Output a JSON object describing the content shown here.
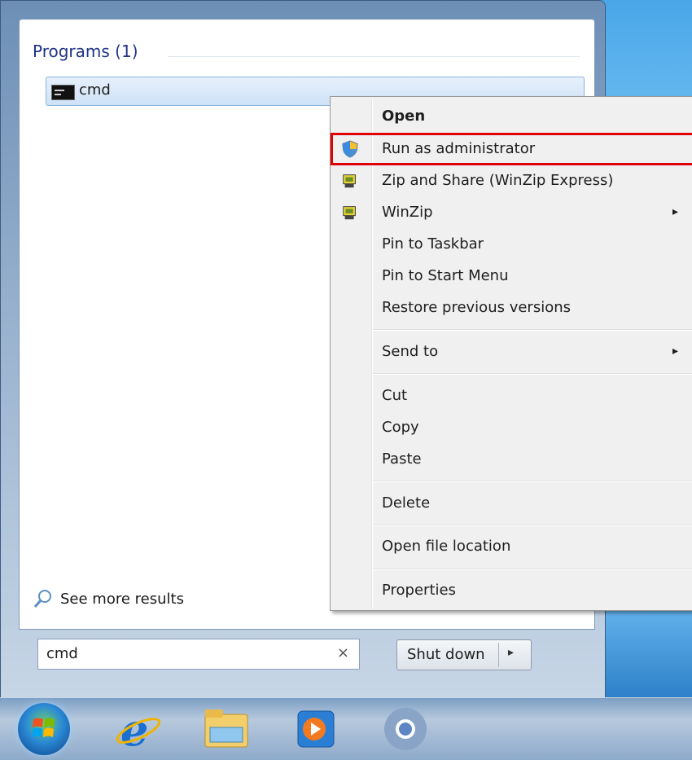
{
  "start_menu": {
    "programs_header": "Programs (1)",
    "program_items": [
      {
        "label": "cmd",
        "icon": "cmd-console-icon"
      }
    ],
    "see_more": "See more results",
    "search": {
      "value": "cmd",
      "clear": "×"
    },
    "shutdown": {
      "label": "Shut down",
      "arrow": "▸"
    }
  },
  "context_menu": {
    "items": [
      {
        "label": "Open",
        "bold": true
      },
      {
        "label": "Run as administrator",
        "icon": "uac-shield-icon",
        "highlighted": true
      },
      {
        "label": "Zip and Share (WinZip Express)",
        "icon": "winzip-icon"
      },
      {
        "label": "WinZip",
        "icon": "winzip-icon",
        "submenu": "▸"
      },
      {
        "label": "Pin to Taskbar"
      },
      {
        "label": "Pin to Start Menu"
      },
      {
        "label": "Restore previous versions"
      },
      {
        "label": "Send to",
        "submenu": "▸"
      },
      {
        "label": "Cut"
      },
      {
        "label": "Copy"
      },
      {
        "label": "Paste"
      },
      {
        "label": "Delete"
      },
      {
        "label": "Open file location"
      },
      {
        "label": "Properties"
      }
    ]
  },
  "taskbar": {
    "items": [
      "start-orb",
      "internet-explorer-icon",
      "windows-explorer-icon",
      "media-player-icon",
      "chrome-icon"
    ]
  },
  "colors": {
    "highlight": "#e00000",
    "header": "#1e3287"
  }
}
